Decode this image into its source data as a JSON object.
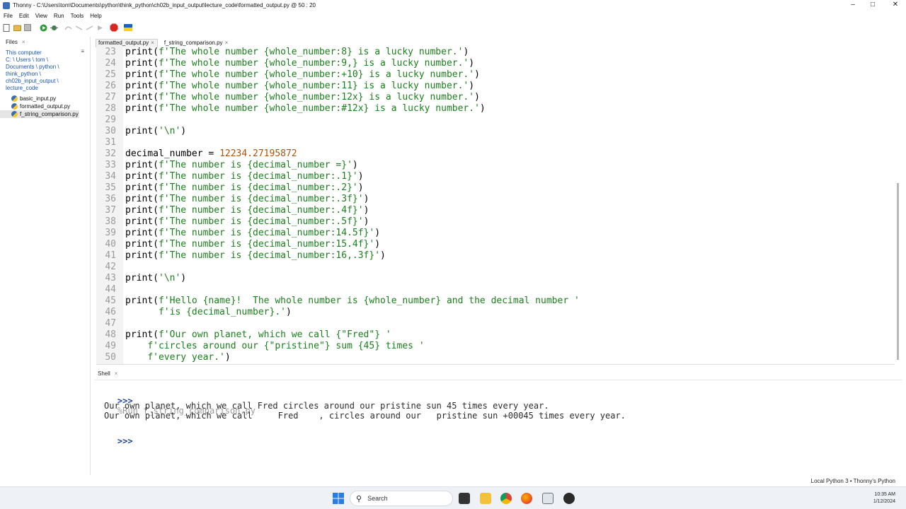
{
  "window": {
    "app_name": "Thonny",
    "title_path": "C:\\Users\\tom\\Documents\\python\\think_python\\ch02b_input_output\\lecture_code\\formatted_output.py",
    "cursor_pos": "50 : 20",
    "minimize": "–",
    "maximize": "□",
    "close": "✕"
  },
  "menu": [
    "File",
    "Edit",
    "View",
    "Run",
    "Tools",
    "Help"
  ],
  "files_pane": {
    "tab_label": "Files",
    "location_lines": [
      "This computer",
      "C: \\ Users \\ tom \\",
      "Documents \\ python \\",
      "think_python \\",
      "ch02b_input_output \\",
      "lecture_code"
    ],
    "files": [
      "basic_input.py",
      "formatted_output.py",
      "f_string_comparison.py"
    ],
    "selected_index": 2
  },
  "editor": {
    "tabs": [
      {
        "label": "formatted_output.py",
        "active": true
      },
      {
        "label": "f_string_comparison.py",
        "active": false
      }
    ],
    "lines": [
      {
        "n": "23",
        "parts": [
          [
            "p",
            "print("
          ],
          [
            "s",
            "f'The whole number {whole_number:8} is a lucky number.'"
          ],
          [
            "p",
            ")"
          ]
        ]
      },
      {
        "n": "24",
        "parts": [
          [
            "p",
            "print("
          ],
          [
            "s",
            "f'The whole number {whole_number:9,} is a lucky number.'"
          ],
          [
            "p",
            ")"
          ]
        ]
      },
      {
        "n": "25",
        "parts": [
          [
            "p",
            "print("
          ],
          [
            "s",
            "f'The whole number {whole_number:+10} is a lucky number.'"
          ],
          [
            "p",
            ")"
          ]
        ]
      },
      {
        "n": "26",
        "parts": [
          [
            "p",
            "print("
          ],
          [
            "s",
            "f'The whole number {whole_number:11} is a lucky number.'"
          ],
          [
            "p",
            ")"
          ]
        ]
      },
      {
        "n": "27",
        "parts": [
          [
            "p",
            "print("
          ],
          [
            "s",
            "f'The whole number {whole_number:12x} is a lucky number.'"
          ],
          [
            "p",
            ")"
          ]
        ]
      },
      {
        "n": "28",
        "parts": [
          [
            "p",
            "print("
          ],
          [
            "s",
            "f'The whole number {whole_number:#12x} is a lucky number.'"
          ],
          [
            "p",
            ")"
          ]
        ]
      },
      {
        "n": "29",
        "parts": []
      },
      {
        "n": "30",
        "parts": [
          [
            "p",
            "print("
          ],
          [
            "s",
            "'\\n'"
          ],
          [
            "p",
            ")"
          ]
        ]
      },
      {
        "n": "31",
        "parts": []
      },
      {
        "n": "32",
        "parts": [
          [
            "p",
            "decimal_number = "
          ],
          [
            "n",
            "12234.27195872"
          ]
        ]
      },
      {
        "n": "33",
        "parts": [
          [
            "p",
            "print("
          ],
          [
            "s",
            "f'The number is {decimal_number =}'"
          ],
          [
            "p",
            ")"
          ]
        ]
      },
      {
        "n": "34",
        "parts": [
          [
            "p",
            "print("
          ],
          [
            "s",
            "f'The number is {decimal_number:.1}'"
          ],
          [
            "p",
            ")"
          ]
        ]
      },
      {
        "n": "35",
        "parts": [
          [
            "p",
            "print("
          ],
          [
            "s",
            "f'The number is {decimal_number:.2}'"
          ],
          [
            "p",
            ")"
          ]
        ]
      },
      {
        "n": "36",
        "parts": [
          [
            "p",
            "print("
          ],
          [
            "s",
            "f'The number is {decimal_number:.3f}'"
          ],
          [
            "p",
            ")"
          ]
        ]
      },
      {
        "n": "37",
        "parts": [
          [
            "p",
            "print("
          ],
          [
            "s",
            "f'The number is {decimal_number:.4f}'"
          ],
          [
            "p",
            ")"
          ]
        ]
      },
      {
        "n": "38",
        "parts": [
          [
            "p",
            "print("
          ],
          [
            "s",
            "f'The number is {decimal_number:.5f}'"
          ],
          [
            "p",
            ")"
          ]
        ]
      },
      {
        "n": "39",
        "parts": [
          [
            "p",
            "print("
          ],
          [
            "s",
            "f'The number is {decimal_number:14.5f}'"
          ],
          [
            "p",
            ")"
          ]
        ]
      },
      {
        "n": "40",
        "parts": [
          [
            "p",
            "print("
          ],
          [
            "s",
            "f'The number is {decimal_number:15.4f}'"
          ],
          [
            "p",
            ")"
          ]
        ]
      },
      {
        "n": "41",
        "parts": [
          [
            "p",
            "print("
          ],
          [
            "s",
            "f'The number is {decimal_number:16,.3f}'"
          ],
          [
            "p",
            ")"
          ]
        ]
      },
      {
        "n": "42",
        "parts": []
      },
      {
        "n": "43",
        "parts": [
          [
            "p",
            "print("
          ],
          [
            "s",
            "'\\n'"
          ],
          [
            "p",
            ")"
          ]
        ]
      },
      {
        "n": "44",
        "parts": []
      },
      {
        "n": "45",
        "parts": [
          [
            "p",
            "print("
          ],
          [
            "s",
            "f'Hello {name}!  The whole number is {whole_number} and the decimal number '"
          ]
        ]
      },
      {
        "n": "46",
        "parts": [
          [
            "p",
            "      "
          ],
          [
            "s",
            "f'is {decimal_number}.'"
          ],
          [
            "p",
            ")"
          ]
        ]
      },
      {
        "n": "47",
        "parts": []
      },
      {
        "n": "48",
        "parts": [
          [
            "p",
            "print("
          ],
          [
            "s",
            "f'Our own planet, which we call {\"Fred\"} '"
          ]
        ]
      },
      {
        "n": "49",
        "parts": [
          [
            "p",
            "    "
          ],
          [
            "s",
            "f'circles around our {\"pristine\"} sum {45} times '"
          ]
        ]
      },
      {
        "n": "50",
        "parts": [
          [
            "p",
            "    "
          ],
          [
            "s",
            "f'every year.'"
          ],
          [
            "p",
            ")"
          ]
        ]
      }
    ]
  },
  "shell": {
    "tab_label": "Shell",
    "prompt": ">>>",
    "run_command": "%Run f_string_comparison.py",
    "output": [
      "Our own planet, which we call Fred circles around our pristine sun 45 times every year.",
      "Our own planet, which we call     Fred    , circles around our   pristine sun +00045 times every year."
    ]
  },
  "status": {
    "interpreter": "Local Python 3  •  Thonny's Python"
  },
  "taskbar": {
    "search_placeholder": "Search",
    "time": "10:35 AM",
    "date": "1/12/2024"
  }
}
